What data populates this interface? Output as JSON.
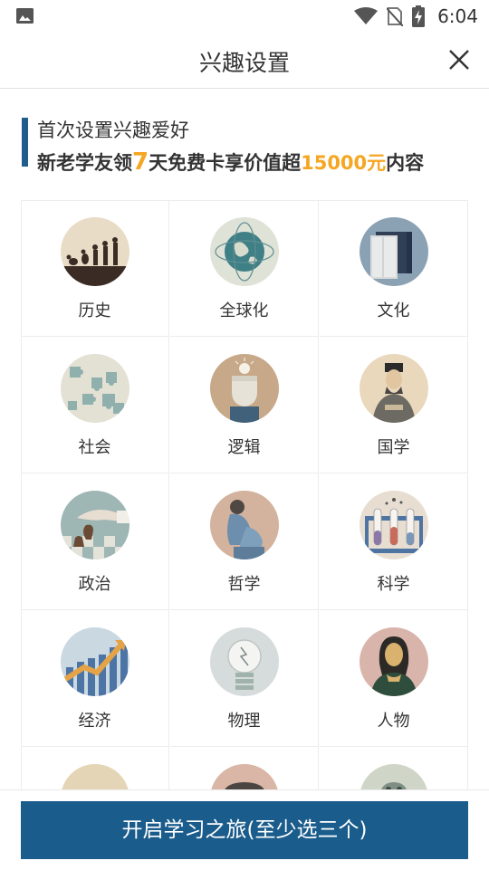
{
  "status_bar": {
    "time": "6:04"
  },
  "header": {
    "title": "兴趣设置"
  },
  "promo": {
    "line1": "首次设置兴趣爱好",
    "line2_a": "新老学友领",
    "line2_days": "7",
    "line2_b": "天免费卡享价值超",
    "line2_amount": "15000元",
    "line2_c": "内容"
  },
  "topics": [
    {
      "label": "历史",
      "icon": "evolution-icon"
    },
    {
      "label": "全球化",
      "icon": "globe-icon"
    },
    {
      "label": "文化",
      "icon": "book-icon"
    },
    {
      "label": "社会",
      "icon": "puzzle-icon"
    },
    {
      "label": "逻辑",
      "icon": "thinking-head-icon"
    },
    {
      "label": "国学",
      "icon": "scholar-portrait-icon"
    },
    {
      "label": "政治",
      "icon": "chess-hand-icon"
    },
    {
      "label": "哲学",
      "icon": "thinker-icon"
    },
    {
      "label": "科学",
      "icon": "test-tubes-icon"
    },
    {
      "label": "经济",
      "icon": "rising-chart-icon"
    },
    {
      "label": "物理",
      "icon": "light-bulb-icon"
    },
    {
      "label": "人物",
      "icon": "mona-lisa-icon"
    }
  ],
  "colors": {
    "accent": "#1a5c8b",
    "highlight": "#f5a623"
  },
  "bottom": {
    "button_label": "开启学习之旅(至少选三个)"
  }
}
